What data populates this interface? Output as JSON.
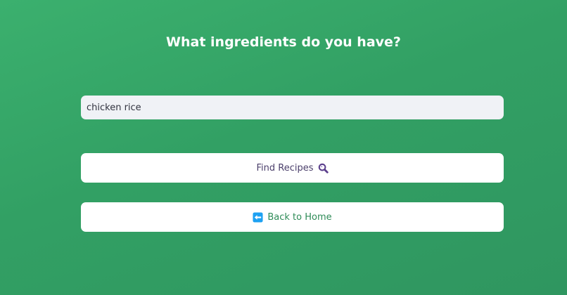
{
  "page": {
    "title": "What ingredients do you have?"
  },
  "search": {
    "value": "chicken rice"
  },
  "buttons": {
    "find_label": "Find Recipes",
    "find_icon": "magnifying-glass-icon",
    "home_label": "Back to Home",
    "home_icon": "left-arrow-icon"
  },
  "colors": {
    "background": "#34a366",
    "accent_blue": "#1da1f2",
    "magnifier": "#5b3f8c"
  }
}
